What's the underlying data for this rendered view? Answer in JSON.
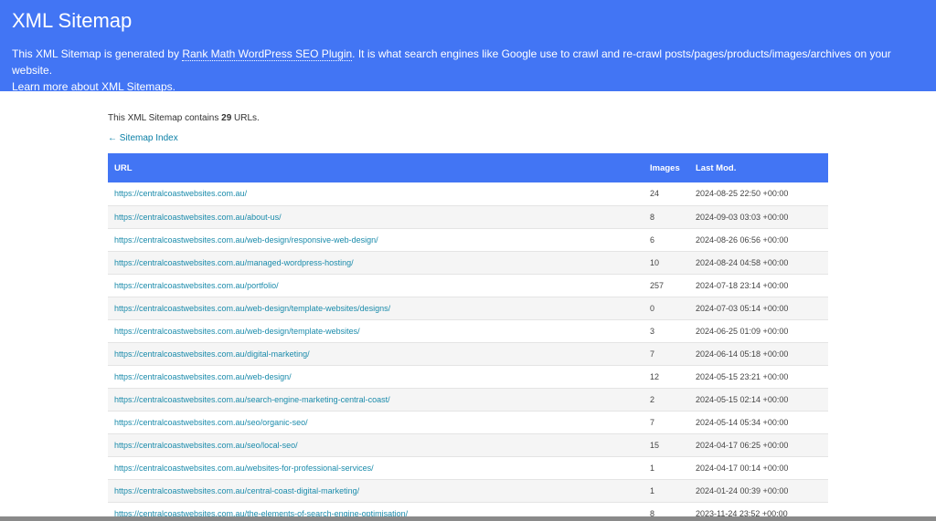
{
  "header": {
    "title": "XML Sitemap",
    "desc_pre": "This XML Sitemap is generated by ",
    "plugin_link": "Rank Math WordPress SEO Plugin",
    "desc_post": ". It is what search engines like Google use to crawl and re-crawl posts/pages/products/images/archives on your website.",
    "learn_pre": "Learn more about ",
    "learn_link": "XML Sitemaps",
    "learn_post": "."
  },
  "summary": {
    "pre": "This XML Sitemap contains ",
    "count": "29",
    "post": " URLs."
  },
  "back_link": "← Sitemap Index",
  "table": {
    "headers": {
      "url": "URL",
      "images": "Images",
      "lastmod": "Last Mod."
    },
    "rows": [
      {
        "url": "https://centralcoastwebsites.com.au/",
        "images": "24",
        "lastmod": "2024-08-25 22:50 +00:00"
      },
      {
        "url": "https://centralcoastwebsites.com.au/about-us/",
        "images": "8",
        "lastmod": "2024-09-03 03:03 +00:00"
      },
      {
        "url": "https://centralcoastwebsites.com.au/web-design/responsive-web-design/",
        "images": "6",
        "lastmod": "2024-08-26 06:56 +00:00"
      },
      {
        "url": "https://centralcoastwebsites.com.au/managed-wordpress-hosting/",
        "images": "10",
        "lastmod": "2024-08-24 04:58 +00:00"
      },
      {
        "url": "https://centralcoastwebsites.com.au/portfolio/",
        "images": "257",
        "lastmod": "2024-07-18 23:14 +00:00"
      },
      {
        "url": "https://centralcoastwebsites.com.au/web-design/template-websites/designs/",
        "images": "0",
        "lastmod": "2024-07-03 05:14 +00:00"
      },
      {
        "url": "https://centralcoastwebsites.com.au/web-design/template-websites/",
        "images": "3",
        "lastmod": "2024-06-25 01:09 +00:00"
      },
      {
        "url": "https://centralcoastwebsites.com.au/digital-marketing/",
        "images": "7",
        "lastmod": "2024-06-14 05:18 +00:00"
      },
      {
        "url": "https://centralcoastwebsites.com.au/web-design/",
        "images": "12",
        "lastmod": "2024-05-15 23:21 +00:00"
      },
      {
        "url": "https://centralcoastwebsites.com.au/search-engine-marketing-central-coast/",
        "images": "2",
        "lastmod": "2024-05-15 02:14 +00:00"
      },
      {
        "url": "https://centralcoastwebsites.com.au/seo/organic-seo/",
        "images": "7",
        "lastmod": "2024-05-14 05:34 +00:00"
      },
      {
        "url": "https://centralcoastwebsites.com.au/seo/local-seo/",
        "images": "15",
        "lastmod": "2024-04-17 06:25 +00:00"
      },
      {
        "url": "https://centralcoastwebsites.com.au/websites-for-professional-services/",
        "images": "1",
        "lastmod": "2024-04-17 00:14 +00:00"
      },
      {
        "url": "https://centralcoastwebsites.com.au/central-coast-digital-marketing/",
        "images": "1",
        "lastmod": "2024-01-24 00:39 +00:00"
      },
      {
        "url": "https://centralcoastwebsites.com.au/the-elements-of-search-engine-optimisation/",
        "images": "8",
        "lastmod": "2023-11-24 23:52 +00:00"
      }
    ]
  },
  "colors": {
    "header_bg": "#4275f4",
    "link": "#1a8bab"
  }
}
